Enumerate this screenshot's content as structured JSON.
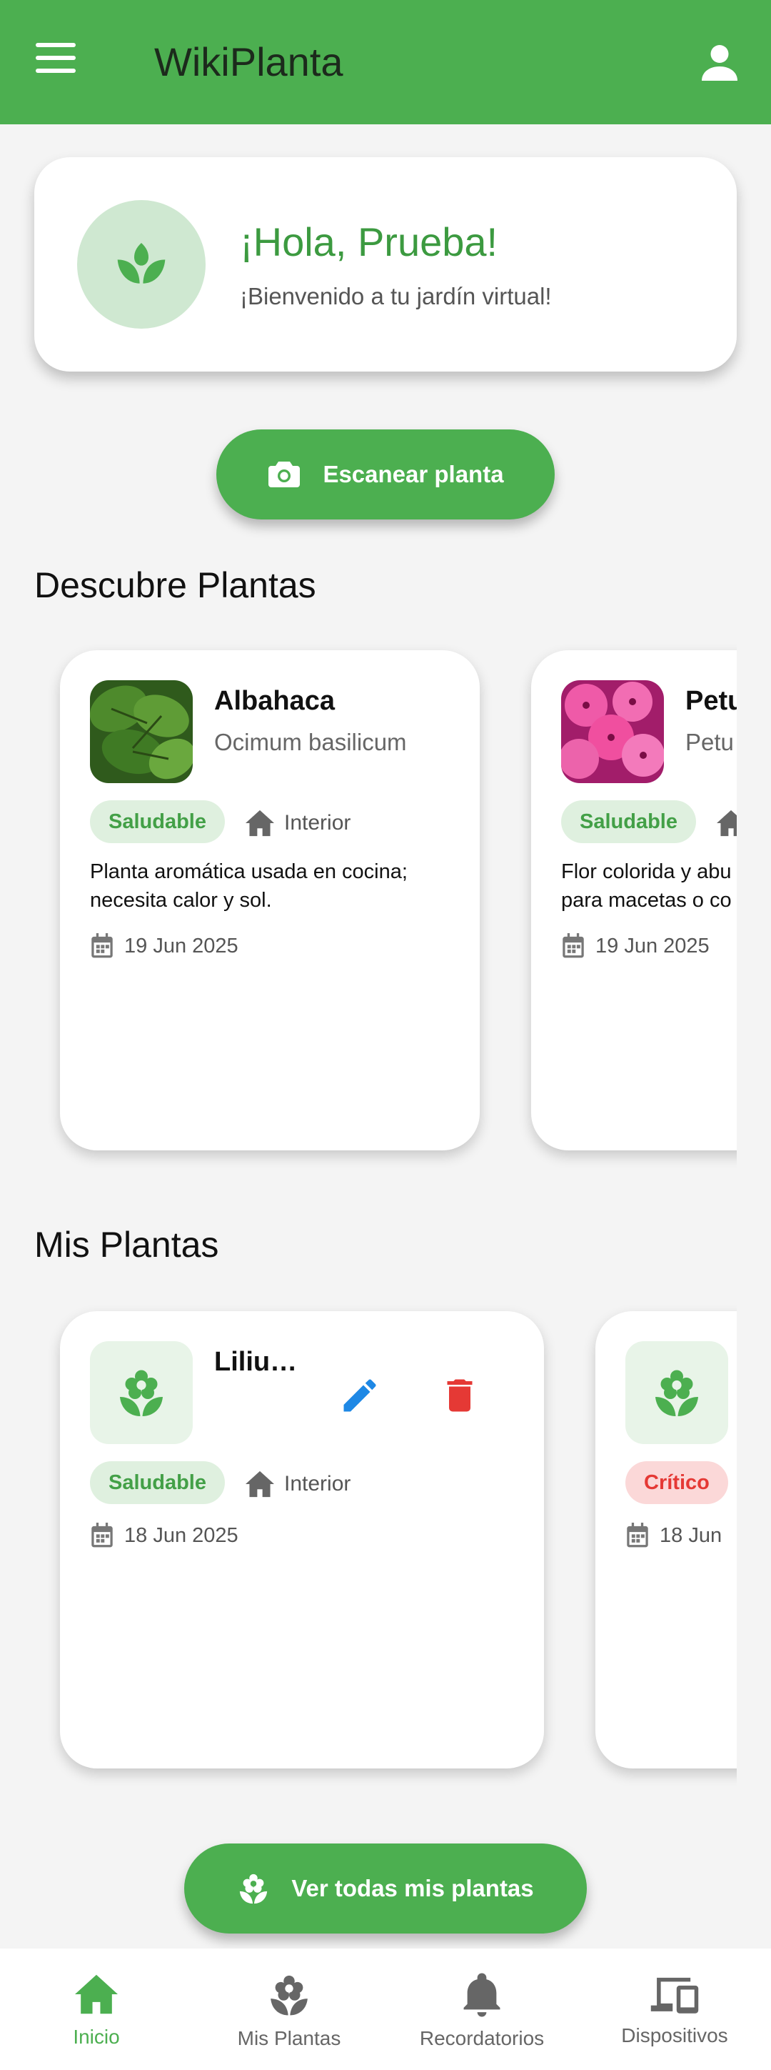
{
  "app": {
    "title": "WikiPlanta"
  },
  "colors": {
    "primary": "#4caf50",
    "danger": "#e53935",
    "edit": "#1e88e5"
  },
  "welcome": {
    "greeting": "¡Hola, Prueba!",
    "subtitle": "¡Bienvenido a tu jardín virtual!"
  },
  "scan_button": {
    "label": "Escanear planta",
    "icon": "camera-icon"
  },
  "discover": {
    "title": "Descubre Plantas",
    "cards": [
      {
        "name": "Albahaca",
        "scientific": "Ocimum basilicum",
        "status": "Saludable",
        "location": "Interior",
        "description": "Planta aromática usada en cocina; necesita calor y sol.",
        "date": "19 Jun 2025"
      },
      {
        "name": "Petu",
        "scientific": "Petu",
        "status": "Saludable",
        "location": "",
        "description": "Flor colorida y abu para macetas o co",
        "date": "19 Jun 2025"
      }
    ]
  },
  "my_plants": {
    "title": "Mis Plantas",
    "cards": [
      {
        "name": "Liliu…",
        "status": "Saludable",
        "location": "Interior",
        "date": "18 Jun 2025"
      },
      {
        "name": "",
        "status": "Crítico",
        "location": "",
        "date": "18 Jun"
      }
    ]
  },
  "view_all_button": {
    "label": "Ver todas mis plantas",
    "icon": "flower-icon"
  },
  "bottom_nav": [
    {
      "label": "Inicio",
      "icon": "home-icon",
      "active": true
    },
    {
      "label": "Mis Plantas",
      "icon": "flower-icon",
      "active": false
    },
    {
      "label": "Recordatorios",
      "icon": "bell-icon",
      "active": false
    },
    {
      "label": "Dispositivos",
      "icon": "devices-icon",
      "active": false
    }
  ]
}
